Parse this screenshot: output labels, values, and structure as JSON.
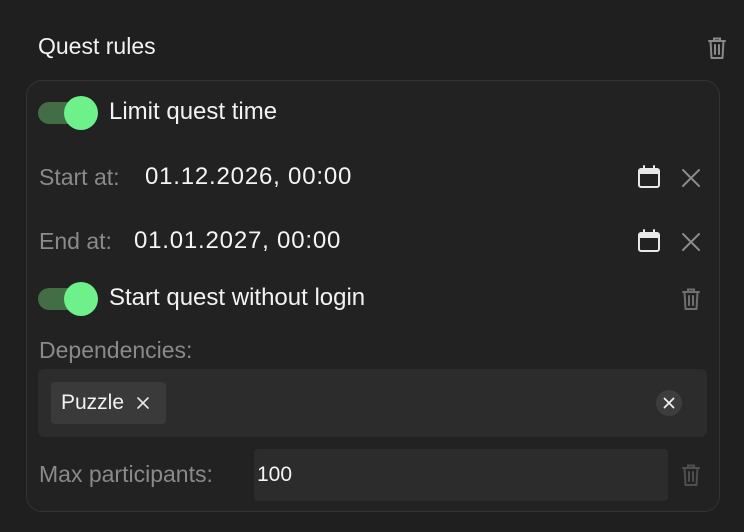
{
  "header": {
    "title": "Quest rules"
  },
  "limit_time": {
    "label": "Limit quest time",
    "enabled": true
  },
  "start": {
    "label": "Start at:",
    "value": "01.12.2026, 00:00"
  },
  "end": {
    "label": "End at:",
    "value": "01.01.2027, 00:00"
  },
  "no_login": {
    "label": "Start quest without login",
    "enabled": true
  },
  "dependencies": {
    "label": "Dependencies:",
    "chips": [
      {
        "label": "Puzzle"
      }
    ]
  },
  "max_participants": {
    "label": "Max participants:",
    "value": "100"
  },
  "colors": {
    "accent": "#6ef08a",
    "track": "#436e45",
    "background": "#1f1f1f",
    "card": "#222222",
    "muted_text": "#8a8a8a"
  },
  "icons": {
    "delete": "trash-icon",
    "calendar": "calendar-icon",
    "clear": "close-icon"
  }
}
